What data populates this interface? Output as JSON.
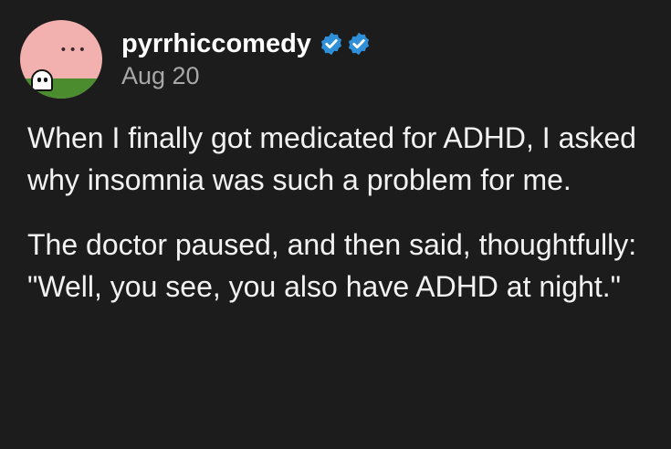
{
  "post": {
    "author": {
      "username": "pyrrhiccomedy",
      "avatar": "avatar-image",
      "badges": [
        "verified-badge-icon",
        "verified-badge-icon"
      ]
    },
    "date": "Aug 20",
    "paragraphs": [
      "When I finally got medicated for ADHD, I asked why insomnia was such a problem for me.",
      "The doctor paused, and then said, thoughtfully: \"Well, you see, you also have ADHD at night.\""
    ]
  },
  "colors": {
    "background": "#1c1c1c",
    "text": "#f2f2f2",
    "muted": "#a8a8a8",
    "badge": "#2f8fd8"
  }
}
